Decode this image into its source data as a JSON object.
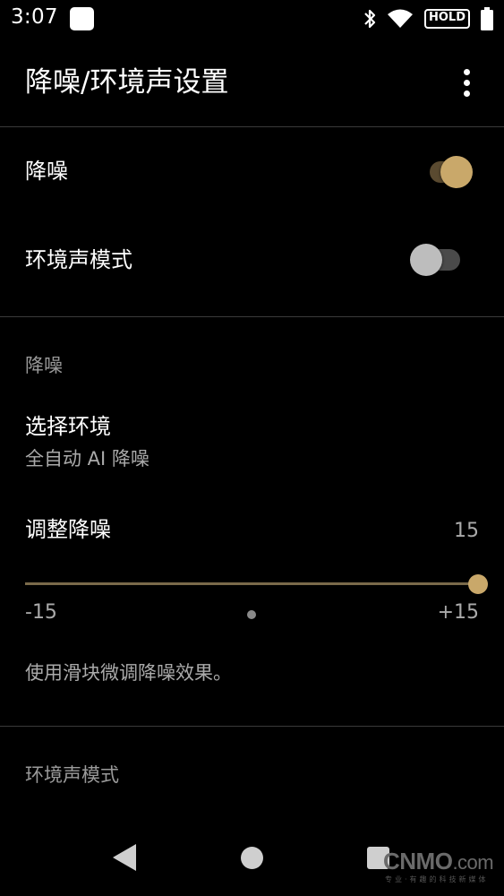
{
  "status_bar": {
    "time": "3:07",
    "hold_label": "HOLD",
    "icons": [
      "app-notification-icon",
      "bluetooth-icon",
      "wifi-icon",
      "hold-badge",
      "battery-icon"
    ]
  },
  "app_bar": {
    "title": "降噪/环境声设置",
    "more_icon": "more-vert-icon"
  },
  "toggles": [
    {
      "label": "降噪",
      "on": true
    },
    {
      "label": "环境声模式",
      "on": false
    }
  ],
  "noise_section": {
    "header": "降噪",
    "select_environment": {
      "title": "选择环境",
      "value": "全自动 AI 降噪"
    },
    "adjust": {
      "title": "调整降噪",
      "value": "15",
      "min_label": "-15",
      "max_label": "+15",
      "min": -15,
      "max": 15,
      "current": 15
    },
    "hint": "使用滑块微调降噪效果。"
  },
  "ambient_section": {
    "header": "环境声模式"
  },
  "nav_bar": {
    "items": [
      "back-icon",
      "home-icon",
      "recents-icon"
    ]
  },
  "watermark": {
    "main": "CNMO",
    "suffix": ".com",
    "sub": "专业·有趣的科技新媒体"
  },
  "colors": {
    "background": "#000000",
    "accent": "#c9a86a",
    "accent_track": "#5a4a30",
    "switch_off_thumb": "#bdbdbd",
    "switch_off_track": "#4a4a4a",
    "secondary_text": "#9a9a9a",
    "divider": "#3a3a3a"
  }
}
